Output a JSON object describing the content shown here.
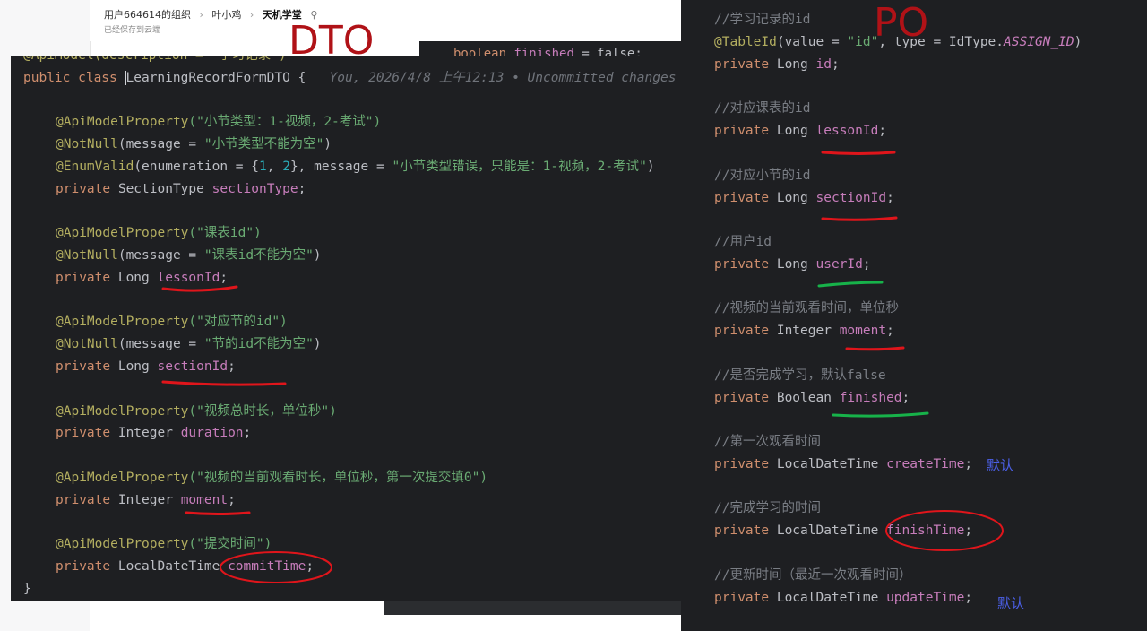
{
  "doc": {
    "breadcrumbs": [
      "用户664614的组织",
      "叶小鸡",
      "天机学堂"
    ],
    "breadcrumb_sep": "›",
    "pin_icon": "pin-icon",
    "saved_status": "已经保存到云端"
  },
  "labels": {
    "dto": "DTO",
    "po": "PO"
  },
  "bg_peek": {
    "kw": "boolean",
    "field": "finished",
    "rest": " = false;"
  },
  "dto": {
    "line0": "@ApiModel(description = \"学习记录\")",
    "class_kw": "public class",
    "class_name": "LearningRecordFormDTO",
    "brace_open": " {",
    "blame": "You, 2026/4/8 上午12:13 • Uncommitted changes",
    "l_sectionType_ann1": "@ApiModelProperty",
    "l_sectionType_str1": "(\"小节类型：1-视频，2-考试\")",
    "l_sectionType_ann2": "@NotNull",
    "l_sectionType_rest2": "(message = ",
    "l_sectionType_str2": "\"小节类型不能为空\"",
    "l_sectionType_close2": ")",
    "l_sectionType_ann3": "@EnumValid",
    "l_sectionType_rest3": "(enumeration = {",
    "num1": "1",
    "comma": ", ",
    "num2": "2",
    "l_sectionType_rest3b": "}, message = ",
    "l_sectionType_str3": "\"小节类型错误，只能是：1-视频，2-考试\"",
    "l_sectionType_close3": ")",
    "private": "private",
    "type_sectionType": "SectionType",
    "field_sectionType": "sectionType",
    "semi": ";",
    "lesson_ann1": "@ApiModelProperty",
    "lesson_str1": "(\"课表id\")",
    "lesson_ann2": "@NotNull",
    "lesson_rest2": "(message = ",
    "lesson_str2": "\"课表id不能为空\"",
    "type_long": "Long",
    "field_lessonId": "lessonId",
    "section_str1": "(\"对应节的id\")",
    "section_str2": "\"节的id不能为空\"",
    "field_sectionId": "sectionId",
    "duration_str": "(\"视频总时长，单位秒\")",
    "type_integer": "Integer",
    "field_duration": "duration",
    "moment_str": "(\"视频的当前观看时长，单位秒，第一次提交填0\")",
    "field_moment": "moment",
    "commit_str": "(\"提交时间\")",
    "type_ldt": "LocalDateTime",
    "field_commitTime": "commitTime",
    "brace_close": "}"
  },
  "po": {
    "c_id": "//学习记录的id",
    "tableid_ann": "@TableId",
    "tableid_rest": "(value = ",
    "tableid_str": "\"id\"",
    "tableid_rest2": ", type = IdType.",
    "tableid_const": "ASSIGN_ID",
    "tableid_close": ")",
    "private": "private",
    "type_long": "Long",
    "type_integer": "Integer",
    "type_boolean": "Boolean",
    "type_ldt": "LocalDateTime",
    "semi": ";",
    "f_id": "id",
    "c_lesson": "//对应课表的id",
    "f_lessonId": "lessonId",
    "c_section": "//对应小节的id",
    "f_sectionId": "sectionId",
    "c_user": "//用户id",
    "f_userId": "userId",
    "c_moment": "//视频的当前观看时间，单位秒",
    "f_moment": "moment",
    "c_finished": "//是否完成学习，默认false",
    "f_finished": "finished",
    "c_create": "//第一次观看时间",
    "f_createTime": "createTime",
    "note_default": "默认",
    "c_finish": "//完成学习的时间",
    "f_finishTime": "finishTime",
    "c_update": "//更新时间（最近一次观看时间）",
    "f_updateTime": "updateTime"
  },
  "colors": {
    "editor_bg": "#1e1f22",
    "keyword": "#cf8e6d",
    "annotation": "#b3ae60",
    "string": "#6aab73",
    "number": "#2aacb8",
    "field": "#c77dbb",
    "comment": "#7a7e85",
    "mark_red": "#e0151b",
    "mark_green": "#17b24a",
    "note_blue": "#4b5fe6",
    "label_red": "#b01217"
  }
}
